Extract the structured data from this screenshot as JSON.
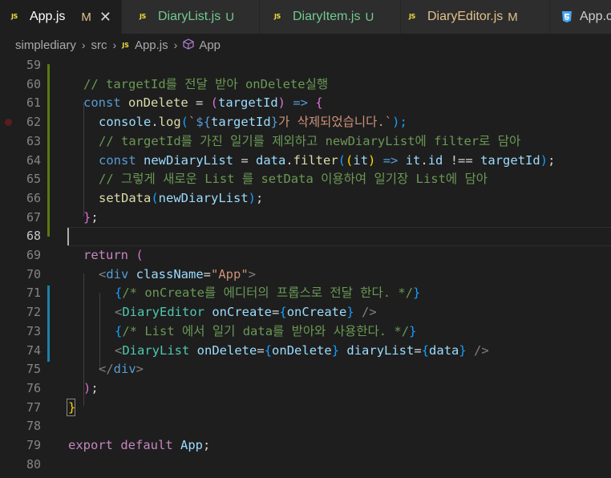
{
  "tabs": [
    {
      "icon": "JS",
      "label": "App.js",
      "status": "M",
      "active": true,
      "close": "✕"
    },
    {
      "icon": "JS",
      "label": "DiaryList.js",
      "status": "U"
    },
    {
      "icon": "JS",
      "label": "DiaryItem.js",
      "status": "U"
    },
    {
      "icon": "JS",
      "label": "DiaryEditor.js",
      "status": "M"
    },
    {
      "icon": "CSS",
      "label": "App.css"
    }
  ],
  "breadcrumb": {
    "folder": "simplediary",
    "sub": "src",
    "file": "App.js",
    "symbol": "App",
    "file_icon": "JS"
  },
  "line_numbers": [
    "59",
    "60",
    "61",
    "62",
    "63",
    "64",
    "65",
    "66",
    "67",
    "68",
    "69",
    "70",
    "71",
    "72",
    "73",
    "74",
    "75",
    "76",
    "77",
    "78",
    "79",
    "80"
  ],
  "code": {
    "l60_comment": "// targetId를 전달 받아 onDelete실행",
    "l61_kw": "const",
    "l61_name": "onDelete",
    "l61_eq": " = ",
    "l61_p1": "(",
    "l61_param": "targetId",
    "l61_p2": ")",
    "l61_arrow": " => ",
    "l61_brace": "{",
    "l62_obj": "console",
    "l62_dot": ".",
    "l62_fn": "log",
    "l62_p1": "(",
    "l62_tick": "`",
    "l62_interp_open": "${",
    "l62_var": "targetId",
    "l62_interp_close": "}",
    "l62_str": "가 삭제되었습니다.`",
    "l62_end": ");",
    "l63_comment": "// targetId를 가진 일기를 제외하고 newDiaryList에 filter로 담아",
    "l64_kw": "const",
    "l64_name": "newDiaryList",
    "l64_eq": " = ",
    "l64_obj": "data",
    "l64_dot": ".",
    "l64_fn": "filter",
    "l64_p1": "(",
    "l64_p2": "(",
    "l64_param": "it",
    "l64_p3": ")",
    "l64_arrow": " => ",
    "l64_it": "it",
    "l64_dot2": ".",
    "l64_id": "id",
    "l64_neq": " !== ",
    "l64_tid": "targetId",
    "l64_p4": ")",
    "l64_semi": ";",
    "l65_comment": "// 그렇게 새로운 List 를 setData 이용하여 일기장 List에 담아",
    "l66_fn": "setData",
    "l66_p1": "(",
    "l66_arg": "newDiaryList",
    "l66_p2": ")",
    "l66_semi": ";",
    "l67_brace": "}",
    "l67_semi": ";",
    "l69_kw": "return",
    "l69_paren": " (",
    "l70_lt": "<",
    "l70_tag": "div",
    "l70_attr": " className",
    "l70_eq": "=",
    "l70_val": "\"App\"",
    "l70_gt": ">",
    "l71_open": "{",
    "l71_comment": "/* onCreate를 에디터의 프롭스로 전달 한다. */",
    "l71_close": "}",
    "l72_lt": "<",
    "l72_comp": "DiaryEditor",
    "l72_attr": " onCreate",
    "l72_eq": "=",
    "l72_open": "{",
    "l72_val": "onCreate",
    "l72_close": "}",
    "l72_end": " />",
    "l73_open": "{",
    "l73_comment": "/* List 에서 일기 data를 받아와 사용한다. */",
    "l73_close": "}",
    "l74_lt": "<",
    "l74_comp": "DiaryList",
    "l74_attr1": " onDelete",
    "l74_eq1": "=",
    "l74_open1": "{",
    "l74_val1": "onDelete",
    "l74_close1": "}",
    "l74_attr2": " diaryList",
    "l74_eq2": "=",
    "l74_open2": "{",
    "l74_val2": "data",
    "l74_close2": "}",
    "l74_end": " />",
    "l75_lt": "</",
    "l75_tag": "div",
    "l75_gt": ">",
    "l76_paren": ")",
    "l76_semi": ";",
    "l77_brace": "}",
    "l79_kw1": "export",
    "l79_kw2": " default",
    "l79_name": " App",
    "l79_semi": ";"
  },
  "colors": {
    "keyword": "#569cd6",
    "comment": "#6a9955",
    "variable": "#9cdcfe",
    "function": "#dcdcaa",
    "string": "#ce9178",
    "component": "#4ec9b0",
    "control": "#c586c0",
    "bracket_gold": "#ffd700",
    "bracket_orchid": "#da70d6",
    "bracket_blue": "#179fff",
    "modified": "#e2c08d",
    "untracked": "#73c991",
    "background": "#1e1e1e"
  }
}
